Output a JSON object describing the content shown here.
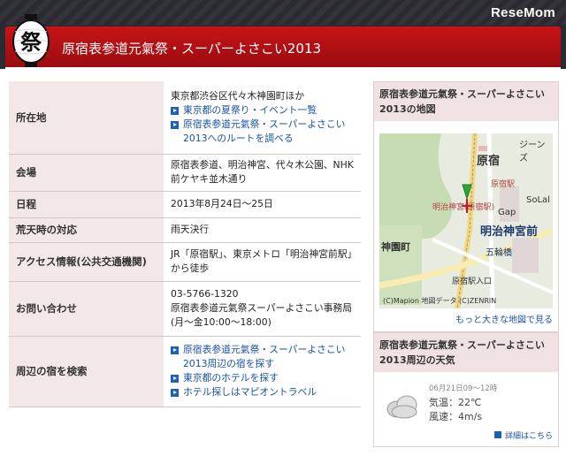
{
  "brand": "ReseMom",
  "header": {
    "lantern_char": "祭",
    "title": "原宿表参道元氣祭・スーパーよさこい2013"
  },
  "info_rows": [
    {
      "key": "所在地",
      "lines": [
        "東京都渋谷区代々木神園町ほか"
      ],
      "links": [
        "東京都の夏祭り・イベント一覧",
        "原宿表参道元氣祭・スーパーよさこい2013へのルートを調べる"
      ]
    },
    {
      "key": "会場",
      "lines": [
        "原宿表参道、明治神宮、代々木公園、NHK前ケヤキ並木通り"
      ],
      "links": []
    },
    {
      "key": "日程",
      "lines": [
        "2013年8月24日～25日"
      ],
      "links": []
    },
    {
      "key": "荒天時の対応",
      "lines": [
        "雨天決行"
      ],
      "links": []
    },
    {
      "key": "アクセス情報(公共交通機関)",
      "lines": [
        "JR「原宿駅」、東京メトロ「明治神宮前駅」から徒歩"
      ],
      "links": []
    },
    {
      "key": "お問い合わせ",
      "lines": [
        "03-5766-1320",
        "原宿表参道元氣祭スーパーよさこい事務局(月～金10:00～18:00)"
      ],
      "links": []
    },
    {
      "key": "周辺の宿を検索",
      "lines": [],
      "links": [
        "原宿表参道元氣祭・スーパーよさこい2013周辺の宿を探す",
        "東京都のホテルを探す",
        "ホテル探しはマピオントラベル"
      ]
    }
  ],
  "map_box": {
    "title": "原宿表参道元氣祭・スーパーよさこい2013の地図",
    "labels": {
      "harajuku": "原宿",
      "jingumae": "明治神宮前",
      "jinnanmachi": "神園町",
      "gap": "Gap",
      "solal": "SoLal",
      "jeans": "ジーンズ",
      "gorinbashi": "五輪橋",
      "harajuku_st": "原宿駅",
      "meiji_st": "明治神宮(原宿駅)",
      "iriguchi": "原宿駅入口",
      "copyright": "(C)Mapion 地図データ (C)ZENRIN"
    },
    "more_link": "もっと大きな地図で見る"
  },
  "weather_box": {
    "title": "原宿表参道元氣祭・スーパーよさこい2013周辺の天気",
    "date": "06月21日09～12時",
    "temp": "気温：22℃",
    "wind": "風速：4m/s",
    "more_link": "詳細はこちら"
  }
}
